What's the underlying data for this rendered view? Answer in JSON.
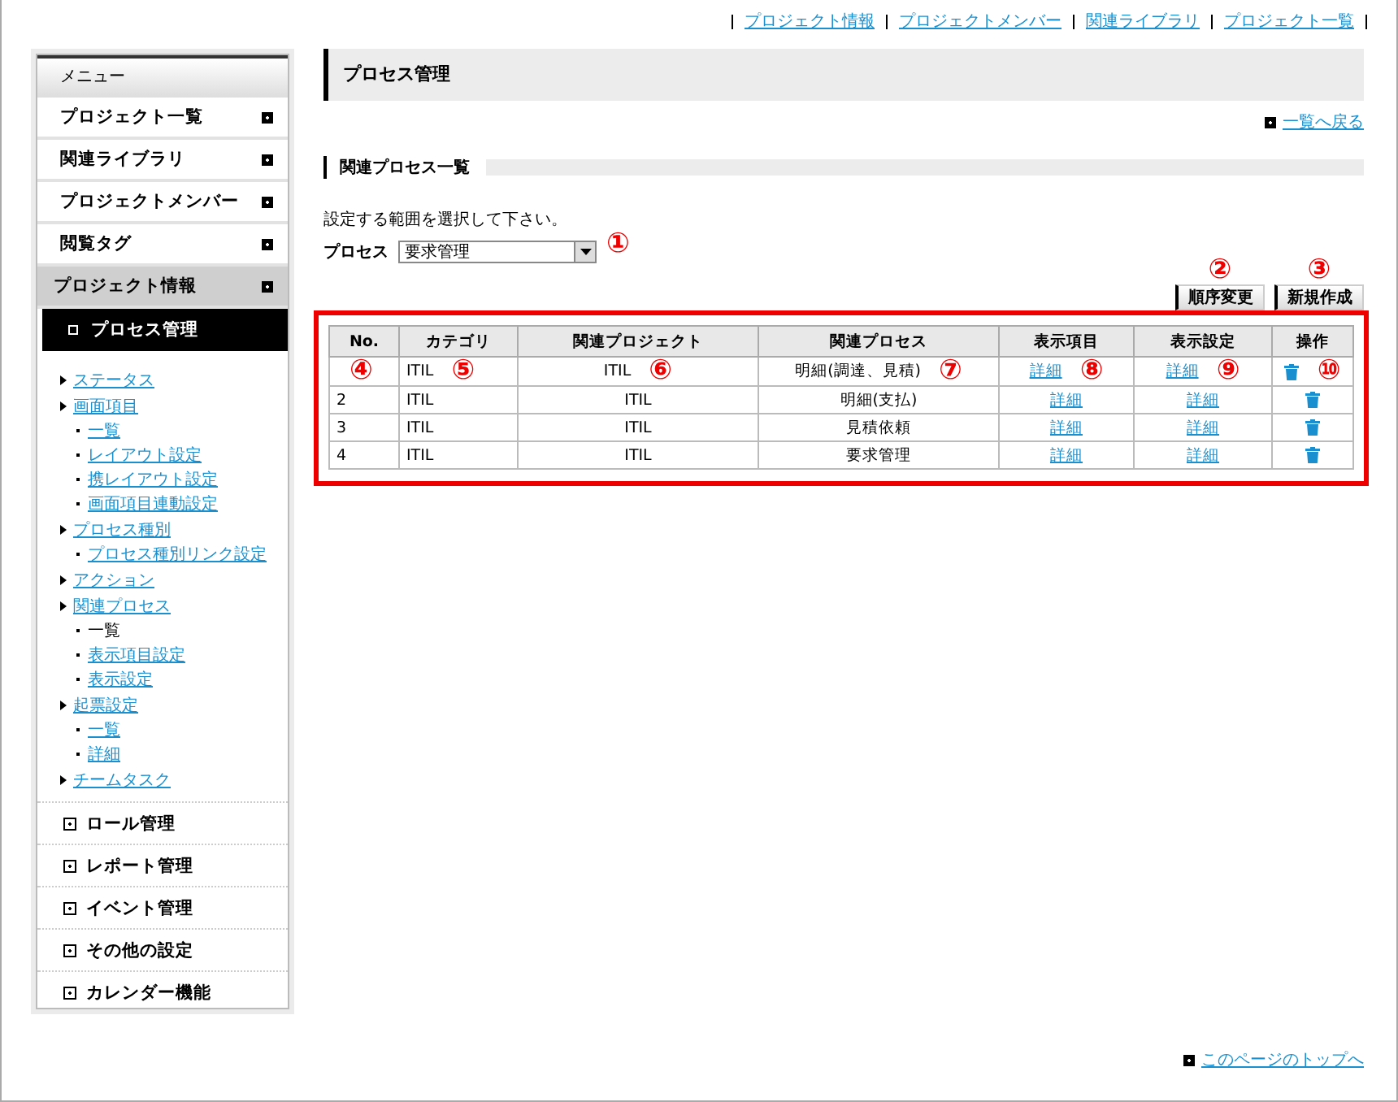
{
  "top_links": [
    "プロジェクト情報",
    "プロジェクトメンバー",
    "関連ライブラリ",
    "プロジェクト一覧"
  ],
  "sidebar": {
    "header": "メニュー",
    "items": [
      {
        "label": "プロジェクト一覧",
        "selected": false
      },
      {
        "label": "関連ライブラリ",
        "selected": false
      },
      {
        "label": "プロジェクトメンバー",
        "selected": false
      },
      {
        "label": "閲覧タグ",
        "selected": false
      },
      {
        "label": "プロジェクト情報",
        "selected": true
      }
    ],
    "active_sub": "プロセス管理",
    "tree": [
      {
        "label": "ステータス",
        "current": false
      },
      {
        "label": "画面項目",
        "current": false,
        "children": [
          {
            "label": "一覧",
            "current": false
          },
          {
            "label": "レイアウト設定",
            "current": false
          },
          {
            "label": "携レイアウト設定",
            "current": false
          },
          {
            "label": "画面項目連動設定",
            "current": false
          }
        ]
      },
      {
        "label": "プロセス種別",
        "current": false,
        "children": [
          {
            "label": "プロセス種別リンク設定",
            "current": false
          }
        ]
      },
      {
        "label": "アクション",
        "current": false
      },
      {
        "label": "関連プロセス",
        "current": false,
        "children": [
          {
            "label": "一覧",
            "current": true
          },
          {
            "label": "表示項目設定",
            "current": false
          },
          {
            "label": "表示設定",
            "current": false
          }
        ]
      },
      {
        "label": "起票設定",
        "current": false,
        "children": [
          {
            "label": "一覧",
            "current": false
          },
          {
            "label": "詳細",
            "current": false
          }
        ]
      },
      {
        "label": "チームタスク",
        "current": false
      }
    ],
    "bottom_items": [
      "ロール管理",
      "レポート管理",
      "イベント管理",
      "その他の設定",
      "カレンダー機能"
    ]
  },
  "page_title": "プロセス管理",
  "back_link": "一覧へ戻る",
  "section_title": "関連プロセス一覧",
  "instruction": "設定する範囲を選択して下さい。",
  "process": {
    "label": "プロセス",
    "value": "要求管理",
    "callout": "①"
  },
  "buttons": [
    {
      "label": "順序変更",
      "callout": "②"
    },
    {
      "label": "新規作成",
      "callout": "③"
    }
  ],
  "table": {
    "columns": [
      "No.",
      "カテゴリ",
      "関連プロジェクト",
      "関連プロセス",
      "表示項目",
      "表示設定",
      "操作"
    ],
    "rows": [
      {
        "cells": [
          {
            "kind": "text",
            "callout": "④"
          },
          {
            "kind": "text",
            "text": "ITIL",
            "callout": "⑤"
          },
          {
            "kind": "text",
            "text": "ITIL",
            "callout": "⑥"
          },
          {
            "kind": "text",
            "text": "明細(調達、見積)",
            "callout": "⑦"
          },
          {
            "kind": "link",
            "text": "詳細",
            "callout": "⑧"
          },
          {
            "kind": "link",
            "text": "詳細",
            "callout": "⑨"
          },
          {
            "kind": "delete",
            "callout": "⑩"
          }
        ]
      },
      {
        "cells": [
          {
            "kind": "text",
            "text": "2"
          },
          {
            "kind": "text",
            "text": "ITIL"
          },
          {
            "kind": "text",
            "text": "ITIL"
          },
          {
            "kind": "text",
            "text": "明細(支払)"
          },
          {
            "kind": "link",
            "text": "詳細"
          },
          {
            "kind": "link",
            "text": "詳細"
          },
          {
            "kind": "delete"
          }
        ]
      },
      {
        "cells": [
          {
            "kind": "text",
            "text": "3"
          },
          {
            "kind": "text",
            "text": "ITIL"
          },
          {
            "kind": "text",
            "text": "ITIL"
          },
          {
            "kind": "text",
            "text": "見積依頼"
          },
          {
            "kind": "link",
            "text": "詳細"
          },
          {
            "kind": "link",
            "text": "詳細"
          },
          {
            "kind": "delete"
          }
        ]
      },
      {
        "cells": [
          {
            "kind": "text",
            "text": "4"
          },
          {
            "kind": "text",
            "text": "ITIL"
          },
          {
            "kind": "text",
            "text": "ITIL"
          },
          {
            "kind": "text",
            "text": "要求管理"
          },
          {
            "kind": "link",
            "text": "詳細"
          },
          {
            "kind": "link",
            "text": "詳細"
          },
          {
            "kind": "delete"
          }
        ]
      }
    ]
  },
  "footer_link": "このページのトップへ"
}
